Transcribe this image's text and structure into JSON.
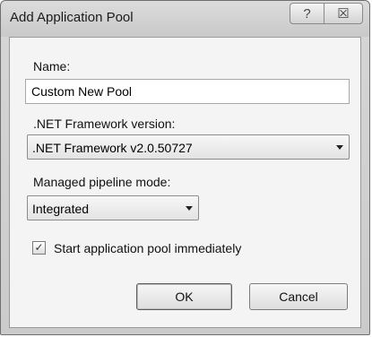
{
  "dialog": {
    "title": "Add Application Pool",
    "help_glyph": "?",
    "close_glyph": "☒"
  },
  "form": {
    "name_label": "Name:",
    "name_value": "Custom New Pool",
    "framework_label": ".NET Framework version:",
    "framework_value": ".NET Framework v2.0.50727",
    "pipeline_label": "Managed pipeline mode:",
    "pipeline_value": "Integrated",
    "start_label": "Start application pool immediately",
    "start_checked": true,
    "checkmark_glyph": "✓"
  },
  "buttons": {
    "ok_label": "OK",
    "cancel_label": "Cancel"
  }
}
